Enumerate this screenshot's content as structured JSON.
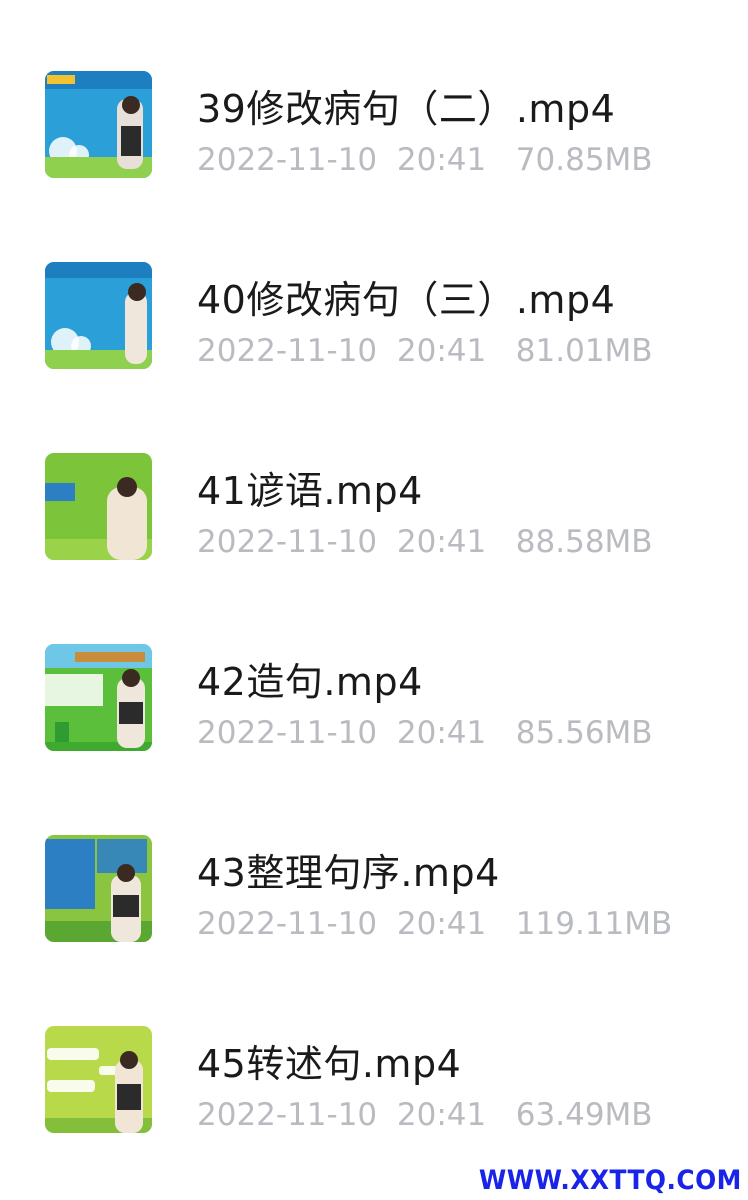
{
  "files": [
    {
      "name": "39修改病句（二）.mp4",
      "date": "2022-11-10",
      "time": "20:41",
      "size": "70.85MB",
      "thumb_bg": "#2a9fd8",
      "thumb_ground": "#8fd14f"
    },
    {
      "name": "40修改病句（三）.mp4",
      "date": "2022-11-10",
      "time": "20:41",
      "size": "81.01MB",
      "thumb_bg": "#2a9fd8",
      "thumb_ground": "#8fd14f"
    },
    {
      "name": "41谚语.mp4",
      "date": "2022-11-10",
      "time": "20:41",
      "size": "88.58MB",
      "thumb_bg": "#7cc43a",
      "thumb_ground": "#9ad24a"
    },
    {
      "name": "42造句.mp4",
      "date": "2022-11-10",
      "time": "20:41",
      "size": "85.56MB",
      "thumb_bg": "#5bbf3b",
      "thumb_ground": "#3faa2f"
    },
    {
      "name": "43整理句序.mp4",
      "date": "2022-11-10",
      "time": "20:41",
      "size": "119.11MB",
      "thumb_bg": "#8bc53f",
      "thumb_ground": "#5aa832"
    },
    {
      "name": "45转述句.mp4",
      "date": "2022-11-10",
      "time": "20:41",
      "size": "63.49MB",
      "thumb_bg": "#b7d94a",
      "thumb_ground": "#84bf3c"
    }
  ],
  "watermark": "WWW.XXTTQ.COM"
}
